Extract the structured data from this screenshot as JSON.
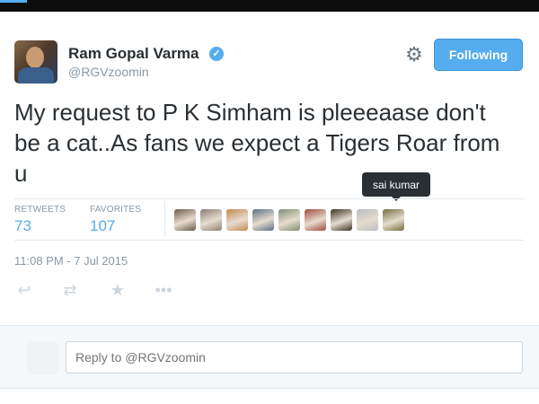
{
  "colors": {
    "accent": "#55acee",
    "text": "#292f33",
    "muted": "#8899a6",
    "reply_panel_bg": "#f5f8fa"
  },
  "tweet": {
    "author_name": "Ram Gopal Varma",
    "author_handle": "@RGVzoomin",
    "text": "My request to P K Simham is pleeeaase don't be a cat..As fans we expect a Tigers Roar from u",
    "timestamp": "11:08 PM - 7 Jul 2015"
  },
  "header": {
    "follow_button_label": "Following",
    "settings_icon": "gear-icon",
    "verified_icon": "verified-badge-icon"
  },
  "stats": {
    "retweets_label": "RETWEETS",
    "retweets_count": "73",
    "favorites_label": "FAVORITES",
    "favorites_count": "107"
  },
  "favoriters": {
    "tooltip_text": "sai kumar",
    "avatar_colors": [
      "#6b5a48",
      "#8c7f73",
      "#c48a4e",
      "#5d6f84",
      "#7e8d73",
      "#a04b3c",
      "#3b3326",
      "#b8bcc2",
      "#75703f"
    ]
  },
  "actions": {
    "reply_icon": "reply-icon",
    "retweet_icon": "retweet-icon",
    "favorite_icon": "star-icon",
    "more_icon": "more-icon"
  },
  "reply": {
    "placeholder": "Reply to @RGVzoomin"
  }
}
